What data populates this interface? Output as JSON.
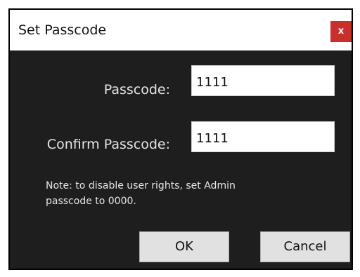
{
  "dialog": {
    "title": "Set Passcode",
    "close_label": "x"
  },
  "fields": {
    "passcode_label": "Passcode:",
    "passcode_value": "1111",
    "confirm_label": "Confirm Passcode:",
    "confirm_value": "1111"
  },
  "note": "Note: to disable user rights, set Admin passcode to 0000.",
  "buttons": {
    "ok_label": "OK",
    "cancel_label": "Cancel"
  },
  "colors": {
    "dialog_background": "#1e1e1e",
    "title_bar_background": "#ffffff",
    "close_button": "#c9302c",
    "button_face": "#e1e1e1"
  }
}
